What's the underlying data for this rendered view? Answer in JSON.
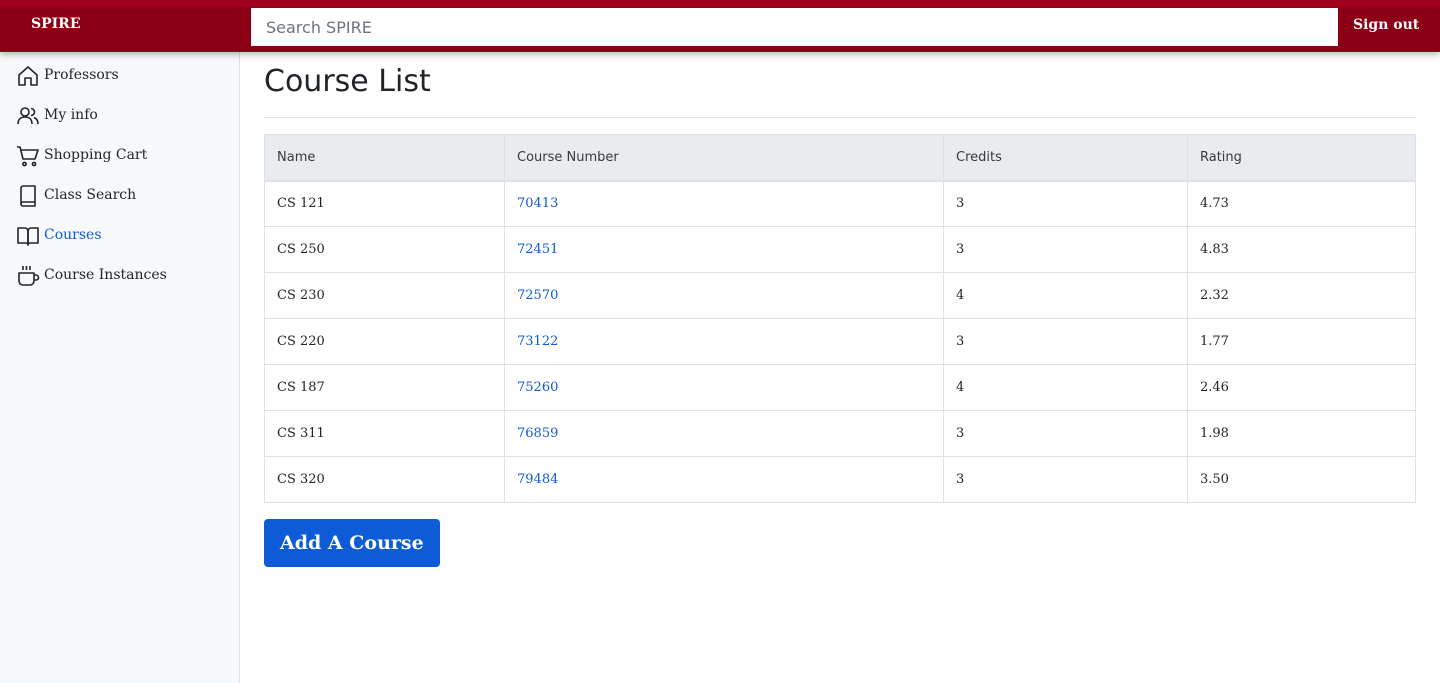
{
  "navbar": {
    "brand": "SPIRE",
    "search_placeholder": "Search SPIRE",
    "signout_label": "Sign out"
  },
  "sidebar": {
    "items": [
      {
        "label": "Professors",
        "icon": "home-icon"
      },
      {
        "label": "My info",
        "icon": "people-icon"
      },
      {
        "label": "Shopping Cart",
        "icon": "cart-icon"
      },
      {
        "label": "Class Search",
        "icon": "book-icon"
      },
      {
        "label": "Courses",
        "icon": "open-book-icon",
        "active": true
      },
      {
        "label": "Course Instances",
        "icon": "cup-icon"
      }
    ]
  },
  "main": {
    "title": "Course List",
    "table": {
      "headers": [
        "Name",
        "Course Number",
        "Credits",
        "Rating"
      ],
      "rows": [
        [
          "CS 121",
          "70413",
          "3",
          "4.73"
        ],
        [
          "CS 250",
          "72451",
          "3",
          "4.83"
        ],
        [
          "CS 230",
          "72570",
          "4",
          "2.32"
        ],
        [
          "CS 220",
          "73122",
          "3",
          "1.77"
        ],
        [
          "CS 187",
          "75260",
          "4",
          "2.46"
        ],
        [
          "CS 311",
          "76859",
          "3",
          "1.98"
        ],
        [
          "CS 320",
          "79484",
          "3",
          "3.50"
        ]
      ]
    },
    "add_button_label": "Add A Course"
  },
  "colors": {
    "navbar": "#8c0016",
    "accent": "#0d5bd6"
  }
}
